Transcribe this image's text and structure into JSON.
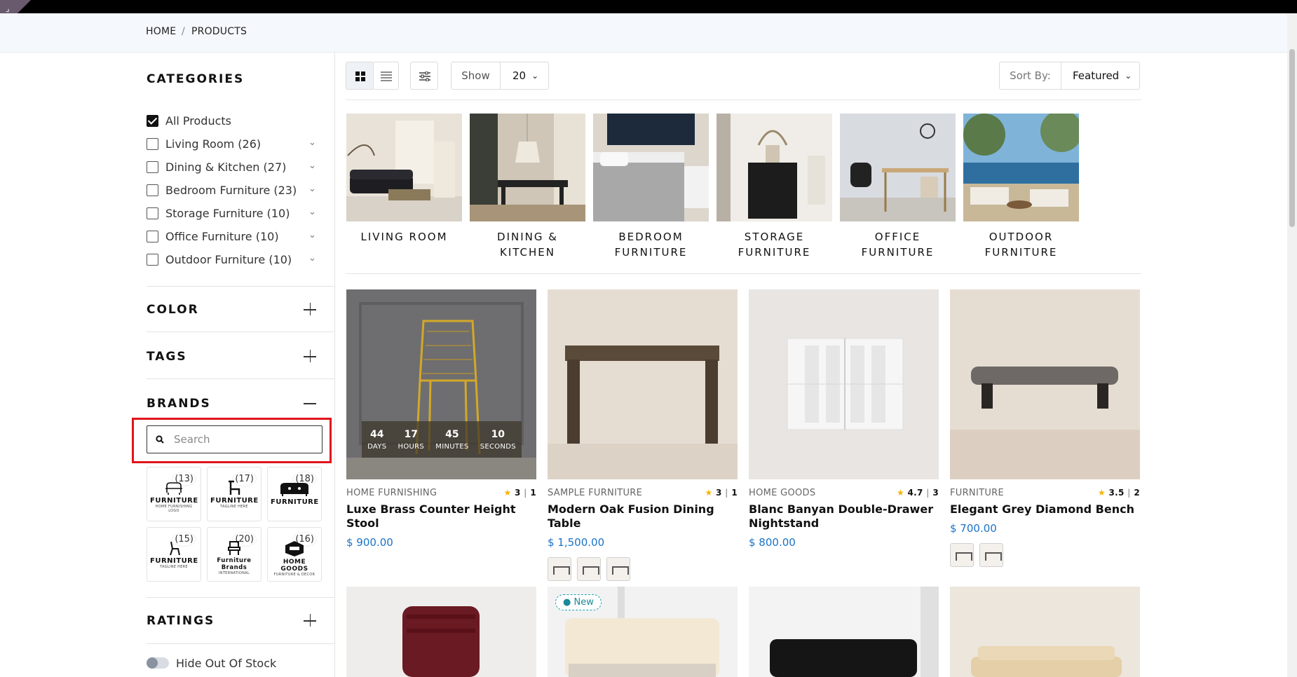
{
  "breadcrumb": {
    "home": "HOME",
    "sep": "/",
    "current": "PRODUCTS"
  },
  "sidebar": {
    "categories_title": "CATEGORIES",
    "categories": [
      {
        "label": "All Products",
        "checked": true
      },
      {
        "label": "Living Room (26)",
        "checked": false
      },
      {
        "label": "Dining & Kitchen (27)",
        "checked": false
      },
      {
        "label": "Bedroom Furniture (23)",
        "checked": false
      },
      {
        "label": "Storage Furniture (10)",
        "checked": false
      },
      {
        "label": "Office Furniture (10)",
        "checked": false
      },
      {
        "label": "Outdoor Furniture (10)",
        "checked": false
      }
    ],
    "color_title": "COLOR",
    "tags_title": "TAGS",
    "brands_title": "BRANDS",
    "brand_search_placeholder": "Search",
    "brands": [
      {
        "count": "(13)",
        "logo": "FURNITURE",
        "sub": "HOME FURNISHING LOGO"
      },
      {
        "count": "(17)",
        "logo": "FURNITURE",
        "sub": "TAGLINE HERE"
      },
      {
        "count": "(18)",
        "logo": "FURNITURE",
        "sub": ""
      },
      {
        "count": "(15)",
        "logo": "FURNITURE",
        "sub": "TAGLINE HERE"
      },
      {
        "count": "(20)",
        "logo": "Furniture Brands",
        "sub": "INTERNATIONAL"
      },
      {
        "count": "(16)",
        "logo": "HOME GOODS",
        "sub": "FURNITURE & DECOR"
      }
    ],
    "ratings_title": "RATINGS",
    "hide_out_of_stock": "Hide Out Of Stock"
  },
  "toolbar": {
    "show_label": "Show",
    "show_value": "20",
    "sort_label": "Sort By:",
    "sort_value": "Featured"
  },
  "category_tiles": [
    {
      "label": "LIVING ROOM"
    },
    {
      "label": "DINING & KITCHEN"
    },
    {
      "label": "BEDROOM FURNITURE"
    },
    {
      "label": "STORAGE FURNITURE"
    },
    {
      "label": "OFFICE FURNITURE"
    },
    {
      "label": "OUTDOOR FURNITURE"
    }
  ],
  "countdown": {
    "days": "44",
    "days_label": "DAYS",
    "hours": "17",
    "hours_label": "HOURS",
    "minutes": "45",
    "minutes_label": "MINUTES",
    "seconds": "10",
    "seconds_label": "SECONDS"
  },
  "products": [
    {
      "brand": "HOME FURNISHING",
      "rating": "3",
      "reviews": "1",
      "name": "Luxe Brass Counter Height Stool",
      "price": "$ 900.00",
      "swatches": 0
    },
    {
      "brand": "SAMPLE FURNITURE",
      "rating": "3",
      "reviews": "1",
      "name": "Modern Oak Fusion Dining Table",
      "price": "$ 1,500.00",
      "swatches": 3
    },
    {
      "brand": "HOME GOODS",
      "rating": "4.7",
      "reviews": "3",
      "name": "Blanc Banyan Double-Drawer Nightstand",
      "price": "$ 800.00",
      "swatches": 0
    },
    {
      "brand": "FURNITURE",
      "rating": "3.5",
      "reviews": "2",
      "name": "Elegant Grey Diamond Bench",
      "price": "$ 700.00",
      "swatches": 2
    }
  ],
  "new_badge": "New",
  "colors": {
    "accent": "#e0141b",
    "price": "#1a73c8",
    "star": "#f5b301"
  }
}
